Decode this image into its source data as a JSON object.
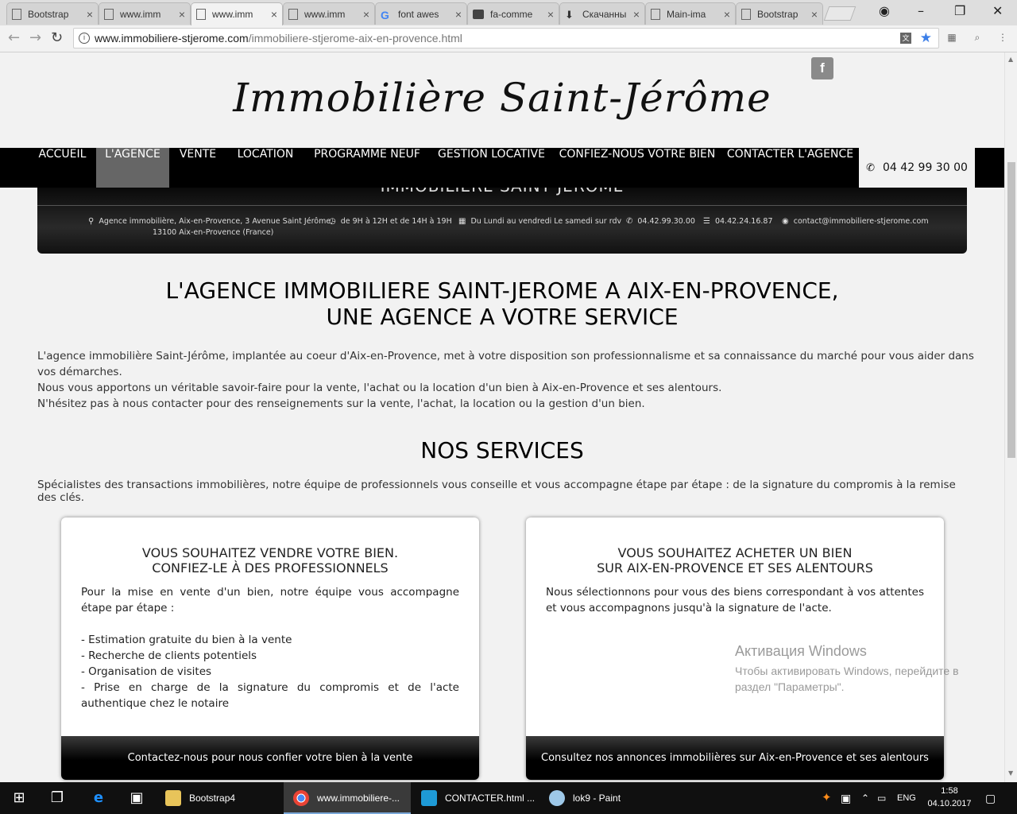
{
  "browser": {
    "tabs": [
      {
        "title": "Bootstrap",
        "icon": "page-icon"
      },
      {
        "title": "www.imm",
        "icon": "page-icon"
      },
      {
        "title": "www.imm",
        "icon": "page-icon",
        "active": true
      },
      {
        "title": "www.imm",
        "icon": "page-icon"
      },
      {
        "title": "font awes",
        "icon": "google-icon"
      },
      {
        "title": "fa-comme",
        "icon": "folder-icon"
      },
      {
        "title": "Скачанны",
        "icon": "download-icon"
      },
      {
        "title": "Main-ima",
        "icon": "page-icon"
      },
      {
        "title": "Bootstrap",
        "icon": "page-icon"
      }
    ],
    "url_host": "www.immobiliere-stjerome.com",
    "url_path": "/immobiliere-stjerome-aix-en-provence.html"
  },
  "site": {
    "logo": "Immobilière Saint-Jérôme",
    "facebook": "f",
    "nav": [
      {
        "label": "ACCUEIL"
      },
      {
        "label": "L'AGENCE",
        "active": true
      },
      {
        "label": "VENTE"
      },
      {
        "label": "LOCATION"
      },
      {
        "label": "PROGRAMME NEUF"
      },
      {
        "label": "GESTION LOCATIVE"
      },
      {
        "label": "CONFIEZ-NOUS VOTRE BIEN"
      },
      {
        "label": "CONTACTER L'AGENCE"
      }
    ],
    "phone": "04 42 99 30 00",
    "banner_title": "IMMOBILIERE SAINT-JEROME",
    "info": {
      "address1": "Agence immobilière, Aix-en-Provence, 3 Avenue Saint Jérôme,",
      "address2": "13100 Aix-en-Provence (France)",
      "hours": "de 9H à 12H et de 14H à 19H",
      "days": "Du Lundi au vendredi Le samedi sur rdv",
      "tel": "04.42.99.30.00",
      "fax": "04.42.24.16.87",
      "email": "contact@immobiliere-stjerome.com"
    },
    "title_line1": "L'AGENCE IMMOBILIERE SAINT-JEROME A AIX-EN-PROVENCE,",
    "title_line2": "UNE AGENCE A VOTRE SERVICE",
    "intro_1": "L'agence immobilière Saint-Jérôme, implantée au coeur d'Aix-en-Provence, met à votre disposition son professionnalisme et sa connaissance du marché pour vous aider dans vos démarches.",
    "intro_2": "Nous vous apportons un véritable savoir-faire pour la vente, l'achat ou la location d'un bien à Aix-en-Provence et ses alentours.",
    "intro_3": "N'hésitez pas à nous contacter pour des renseignements sur la vente, l'achat, la location ou la gestion d'un bien.",
    "services_title": "NOS SERVICES",
    "services_lead": "Spécialistes des transactions immobilières, notre équipe de professionnels vous conseille et vous accompagne étape par étape : de la signature du compromis à la remise des clés.",
    "cards": [
      {
        "title1": "VOUS SOUHAITEZ VENDRE VOTRE BIEN.",
        "title2": "CONFIEZ-LE À DES PROFESSIONNELS",
        "body": "Pour la mise en vente d'un bien, notre équipe vous accompagne étape par étape :",
        "items": [
          "- Estimation gratuite du bien à la vente",
          "- Recherche de clients potentiels",
          "- Organisation de visites",
          "- Prise en charge de la signature du compromis et de l'acte authentique chez le notaire"
        ],
        "footer": "Contactez-nous pour nous confier votre bien à la vente"
      },
      {
        "title1": "VOUS SOUHAITEZ ACHETER UN BIEN",
        "title2": "SUR AIX-EN-PROVENCE ET SES ALENTOURS",
        "body": "Nous sélectionnons pour vous des biens correspondant à vos attentes et vous accompagnons jusqu'à la signature de l'acte.",
        "items": [],
        "footer": "Consultez nos annonces immobilières sur Aix-en-Provence et ses alentours"
      }
    ]
  },
  "watermark": {
    "line1": "Активация Windows",
    "line2": "Чтобы активировать Windows, перейдите в раздел \"Параметры\"."
  },
  "taskbar": {
    "apps": [
      {
        "label": "Bootstrap4"
      },
      {
        "label": "www.immobiliere-..."
      },
      {
        "label": "CONTACTER.html ..."
      },
      {
        "label": "lok9 - Paint"
      }
    ],
    "lang": "ENG",
    "time": "1:58",
    "date": "04.10.2017"
  }
}
